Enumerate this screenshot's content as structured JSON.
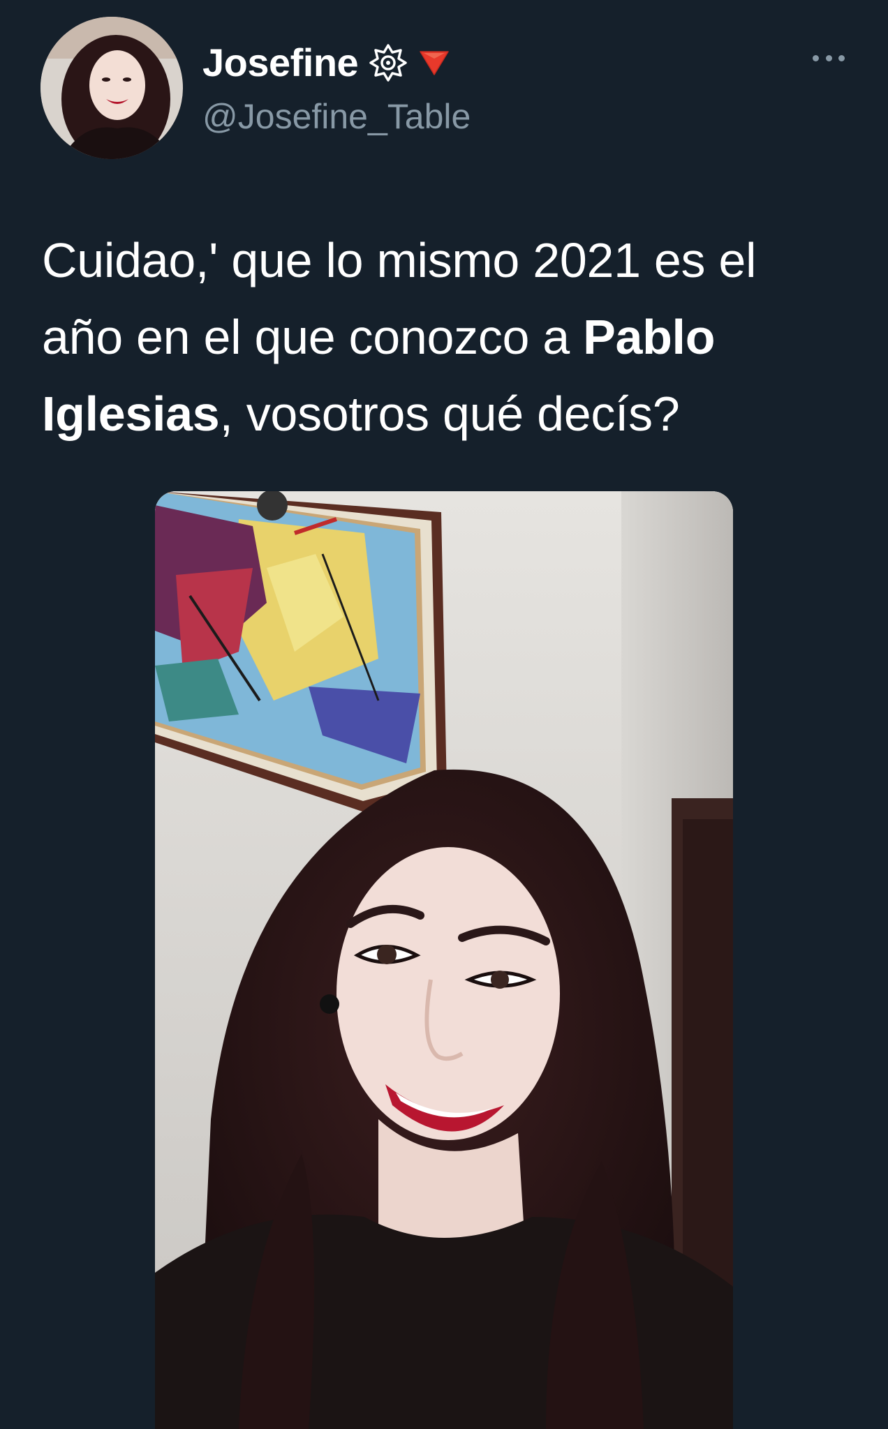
{
  "author": {
    "display_name": "Josefine",
    "handle": "@Josefine_Table"
  },
  "tweet": {
    "text_parts": [
      {
        "text": "Cuidao,' que lo mismo 2021 es el año en el que conozco a ",
        "bold": false
      },
      {
        "text": "Pablo Iglesias",
        "bold": true
      },
      {
        "text": ", vosotros qué decís?",
        "bold": false
      }
    ]
  },
  "icons": {
    "badge": "sun-badge-icon",
    "indicator": "red-triangle-icon",
    "more": "more-options-icon"
  },
  "colors": {
    "background": "#15202b",
    "text_primary": "#ffffff",
    "text_secondary": "#8899a6",
    "triangle": "#e8392b"
  }
}
